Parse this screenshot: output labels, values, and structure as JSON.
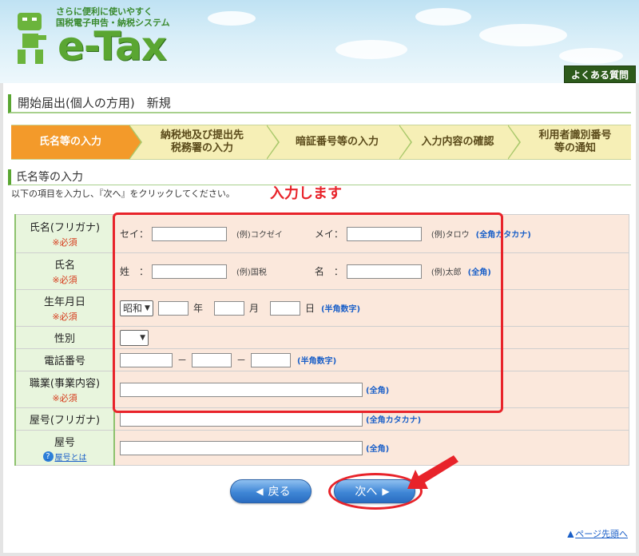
{
  "header": {
    "tagline": "さらに便利に使いやすく\n国税電子申告・納税システム",
    "logo_text": "e-Tax",
    "faq_label": "よくある質問"
  },
  "page_title": "開始届出(個人の方用)　新規",
  "steps": [
    {
      "label": "氏名等の入力",
      "active": true
    },
    {
      "label": "納税地及び提出先\n税務署の入力",
      "active": false
    },
    {
      "label": "暗証番号等の入力",
      "active": false
    },
    {
      "label": "入力内容の確認",
      "active": false
    },
    {
      "label": "利用者識別番号\n等の通知",
      "active": false
    }
  ],
  "section": {
    "title": "氏名等の入力",
    "instructions": "以下の項目を入力し、『次へ』をクリックしてください。",
    "annotation": "入力します"
  },
  "form": {
    "required_label": "※必須",
    "name_kana": {
      "label": "氏名(フリガナ)",
      "sei_label": "セイ：",
      "sei_example": "(例)コクゼイ",
      "mei_label": "メイ：",
      "mei_example": "(例)タロウ",
      "hint": "(全角カタカナ)"
    },
    "name": {
      "label": "氏名",
      "sei_label": "姓　：",
      "sei_example": "(例)国税",
      "mei_label": "名　：",
      "mei_example": "(例)太郎",
      "hint": "(全角)"
    },
    "birth": {
      "label": "生年月日",
      "era": "昭和",
      "year_unit": "年",
      "month_unit": "月",
      "day_unit": "日",
      "hint": "(半角数字)"
    },
    "gender": {
      "label": "性別"
    },
    "phone": {
      "label": "電話番号",
      "sep": "－",
      "hint": "(半角数字)"
    },
    "job": {
      "label": "職業(事業内容)",
      "hint": "(全角)"
    },
    "trade_kana": {
      "label": "屋号(フリガナ)",
      "hint": "(全角カタカナ)"
    },
    "trade": {
      "label": "屋号",
      "help_link": "屋号とは",
      "hint": "(全角)"
    }
  },
  "buttons": {
    "back": "戻る",
    "next": "次へ"
  },
  "page_top": "ページ先頭へ",
  "colors": {
    "accent_green": "#5aa632",
    "active_step": "#f39a2a",
    "annotation_red": "#e8232a",
    "button_blue": "#3f86d6"
  }
}
